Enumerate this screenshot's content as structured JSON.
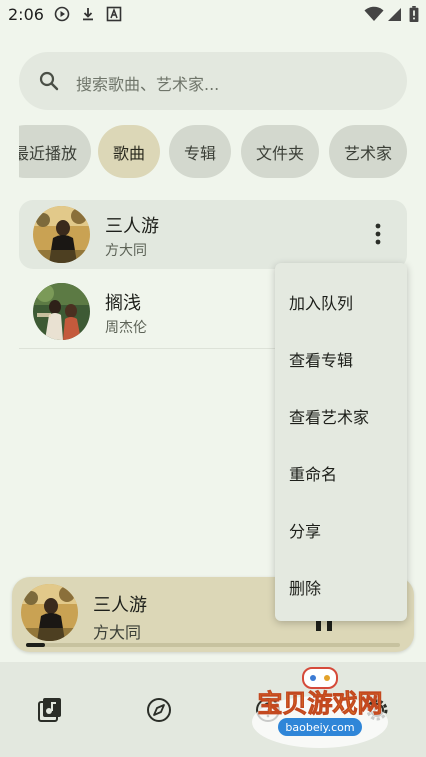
{
  "status_bar": {
    "time": "2:06",
    "icons": [
      "play-circle-icon",
      "download-icon",
      "font-a-icon",
      "wifi-icon",
      "signal-icon",
      "battery-icon"
    ]
  },
  "search": {
    "placeholder": "搜索歌曲、艺术家..."
  },
  "tabs": [
    {
      "label": "最近播放",
      "active": false
    },
    {
      "label": "歌曲",
      "active": true
    },
    {
      "label": "专辑",
      "active": false
    },
    {
      "label": "文件夹",
      "active": false
    },
    {
      "label": "艺术家",
      "active": false
    }
  ],
  "songs": [
    {
      "title": "三人游",
      "artist": "方大同",
      "selected": true
    },
    {
      "title": "搁浅",
      "artist": "周杰伦",
      "selected": false
    }
  ],
  "context_menu": {
    "items": [
      "加入队列",
      "查看专辑",
      "查看艺术家",
      "重命名",
      "分享",
      "删除"
    ]
  },
  "mini_player": {
    "title": "三人游",
    "artist": "方大同",
    "progress": 0.05
  },
  "bottom_nav": {
    "items": [
      "library-music-icon",
      "explore-icon",
      "help-icon",
      "settings-icon"
    ]
  },
  "watermark": {
    "text": "宝贝游戏网",
    "url": "baobeiy.com"
  },
  "colors": {
    "background": "#f0f5ec",
    "chip": "#d3d8ce",
    "chip_active": "#dcd7b7",
    "player": "#dcd7b7",
    "menu": "#e4e9e0"
  }
}
